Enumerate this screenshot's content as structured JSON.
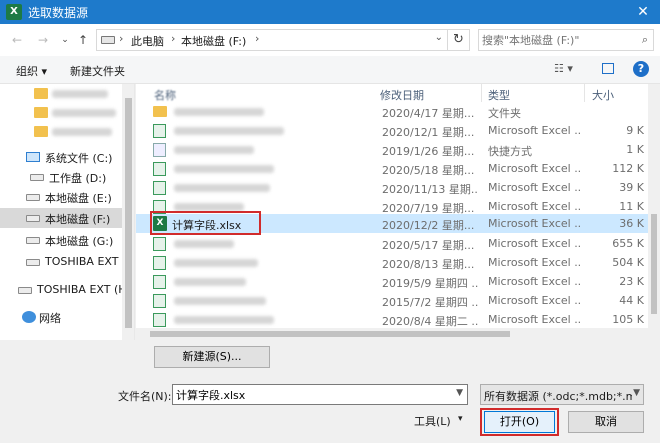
{
  "window": {
    "title": "选取数据源",
    "app_icon": "excel-icon",
    "close_glyph": "✕"
  },
  "nav": {
    "back_glyph": "←",
    "forward_glyph": "→",
    "recent_glyph": "⌄",
    "up_glyph": "↑",
    "breadcrumb": [
      "此电脑",
      "本地磁盘 (F:)"
    ],
    "breadcrumb_sep": "›",
    "dropdown_glyph": "⌄",
    "refresh_glyph": "↻",
    "search_placeholder": "搜索\"本地磁盘 (F:)\"",
    "search_glyph": "⌕"
  },
  "toolbar": {
    "organize_label": "组织 ▾",
    "new_folder_label": "新建文件夹",
    "view_glyph": "☷ ▾",
    "help_glyph": "?"
  },
  "sidebar": {
    "items": [
      {
        "label": "系统文件 (C:)",
        "icon": "drive-icon",
        "selected": false
      },
      {
        "label": "工作盘 (D:)",
        "icon": "drive-icon",
        "selected": false
      },
      {
        "label": "本地磁盘 (E:)",
        "icon": "drive-icon",
        "selected": false
      },
      {
        "label": "本地磁盘 (F:)",
        "icon": "drive-icon",
        "selected": true
      },
      {
        "label": "本地磁盘 (G:)",
        "icon": "drive-icon",
        "selected": false
      },
      {
        "label": "TOSHIBA EXT (",
        "icon": "drive-icon",
        "selected": false
      },
      {
        "label": "TOSHIBA EXT (H",
        "icon": "drive-icon",
        "selected": false
      },
      {
        "label": "网络",
        "icon": "network-icon",
        "selected": false
      }
    ]
  },
  "files": {
    "columns": {
      "name": "名称",
      "date": "修改日期",
      "type": "类型",
      "size": "大小"
    },
    "rows": [
      {
        "name": "",
        "date": "2020/4/17 星期...",
        "type": "文件夹",
        "size": "",
        "selected": false
      },
      {
        "name": "",
        "date": "2020/12/1 星期...",
        "type": "Microsoft Excel ...",
        "size": "9 K",
        "selected": false
      },
      {
        "name": "",
        "date": "2019/1/26 星期...",
        "type": "快捷方式",
        "size": "1 K",
        "selected": false
      },
      {
        "name": "",
        "date": "2020/5/18 星期...",
        "type": "Microsoft Excel ...",
        "size": "112 K",
        "selected": false
      },
      {
        "name": "",
        "date": "2020/11/13 星期...",
        "type": "Microsoft Excel ...",
        "size": "39 K",
        "selected": false
      },
      {
        "name": "",
        "date": "2020/7/19 星期...",
        "type": "Microsoft Excel ...",
        "size": "11 K",
        "selected": false
      },
      {
        "name": "计算字段.xlsx",
        "date": "2020/12/2 星期...",
        "type": "Microsoft Excel ...",
        "size": "36 K",
        "selected": true
      },
      {
        "name": "",
        "date": "2020/5/17 星期...",
        "type": "Microsoft Excel ...",
        "size": "655 K",
        "selected": false
      },
      {
        "name": "",
        "date": "2020/8/13 星期...",
        "type": "Microsoft Excel ...",
        "size": "504 K",
        "selected": false
      },
      {
        "name": "",
        "date": "2019/5/9 星期四 ...",
        "type": "Microsoft Excel ...",
        "size": "23 K",
        "selected": false
      },
      {
        "name": "",
        "date": "2015/7/2 星期四 ...",
        "type": "Microsoft Excel ...",
        "size": "44 K",
        "selected": false
      },
      {
        "name": "",
        "date": "2020/8/4 星期二 ...",
        "type": "Microsoft Excel ...",
        "size": "105 K",
        "selected": false
      }
    ]
  },
  "bottom": {
    "new_source_label": "新建源(S)...",
    "filename_label": "文件名(N):",
    "filename_value": "计算字段.xlsx",
    "filter_value": "所有数据源 (*.odc;*.mdb;*.mdb",
    "tools_label": "工具(L)",
    "tools_glyph": "▾",
    "open_label": "打开(O)",
    "cancel_label": "取消"
  }
}
